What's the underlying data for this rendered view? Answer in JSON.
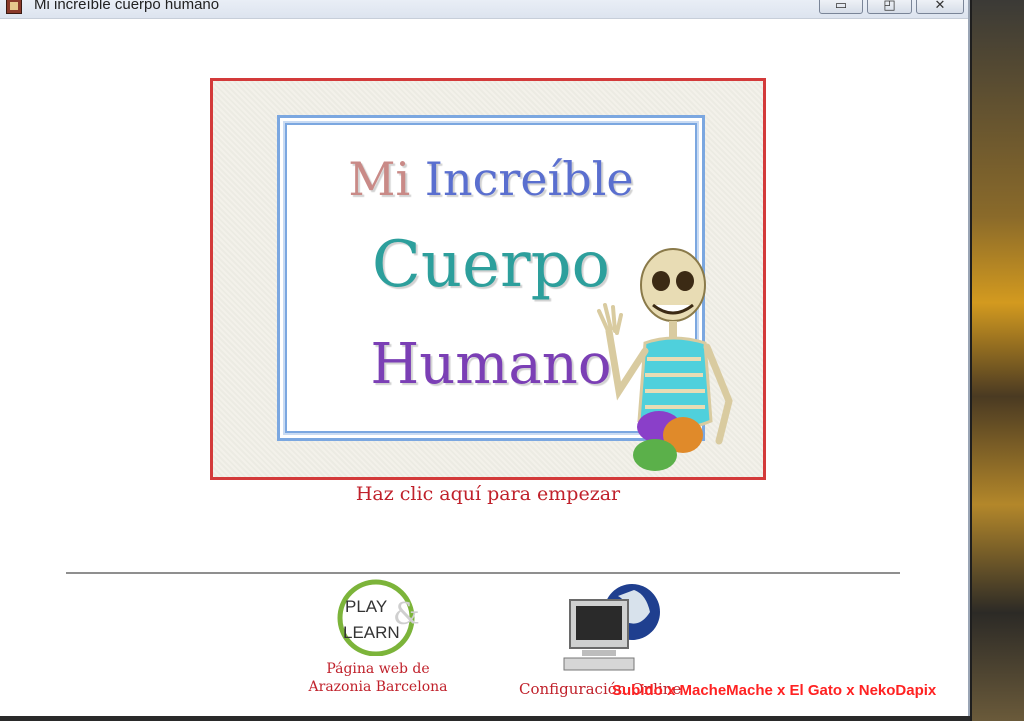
{
  "window": {
    "title": "Mi increíble cuerpo humano",
    "minimize_glyph": "▭",
    "maximize_glyph": "◰",
    "close_glyph": "✕"
  },
  "title_card": {
    "line1": [
      "Mi",
      "Increíble"
    ],
    "line2": "Cuerpo",
    "line3": "Humano"
  },
  "start_prompt": "Haz clic aquí para empezar",
  "play_learn": {
    "logo_text_1": "PLAY",
    "logo_text_2": "LEARN",
    "logo_amp": "&",
    "caption_line1": "Página web de",
    "caption_line2": "Arazonia Barcelona"
  },
  "config": {
    "caption": "Configuración Online"
  },
  "watermark": "Subido x MacheMache x El Gato x NekoDapix",
  "colors": {
    "frame_red": "#d33a3a",
    "frame_blue": "#7ba7e0",
    "link_red": "#c0212b"
  }
}
